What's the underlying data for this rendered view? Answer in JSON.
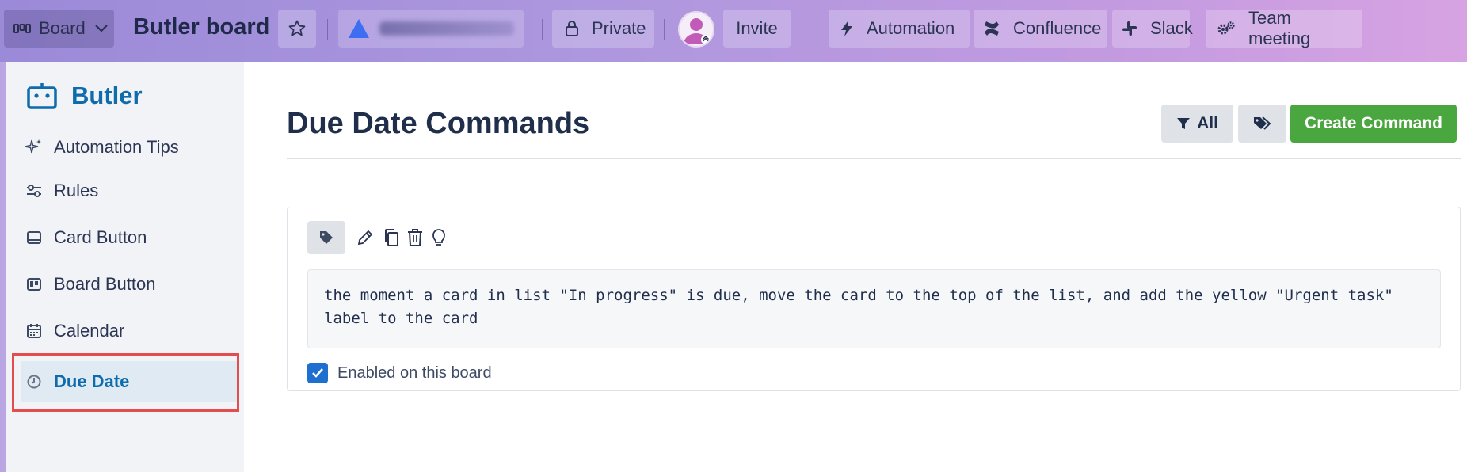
{
  "topbar": {
    "view_label": "Board",
    "board_title": "Butler board",
    "visibility_label": "Private",
    "invite_label": "Invite",
    "power_ups": [
      {
        "label": "Automation",
        "icon": "lightning-icon"
      },
      {
        "label": "Confluence",
        "icon": "confluence-icon"
      },
      {
        "label": "Slack",
        "icon": "slack-icon"
      },
      {
        "label": "Team meeting",
        "icon": "gears-icon"
      }
    ]
  },
  "sidebar": {
    "title": "Butler",
    "items": [
      {
        "label": "Automation Tips",
        "icon": "sparkle-icon"
      },
      {
        "label": "Rules",
        "icon": "sliders-icon"
      },
      {
        "label": "Card Button",
        "icon": "card-icon"
      },
      {
        "label": "Board Button",
        "icon": "board-icon"
      },
      {
        "label": "Calendar",
        "icon": "calendar-icon"
      },
      {
        "label": "Due Date",
        "icon": "clock-icon",
        "active": true
      }
    ]
  },
  "main": {
    "title": "Due Date Commands",
    "filter_label": "All",
    "create_label": "Create Command",
    "command": {
      "text": "the moment a card in list \"In progress\" is due, move the card to the top of the list, and add the yellow \"Urgent task\" label to the card",
      "enabled_label": "Enabled on this board",
      "enabled": true
    }
  },
  "colors": {
    "accent": "#0e6cad",
    "create_button": "#4aa63e",
    "highlight_border": "#e44d4d",
    "checkbox": "#1e6fd0"
  }
}
